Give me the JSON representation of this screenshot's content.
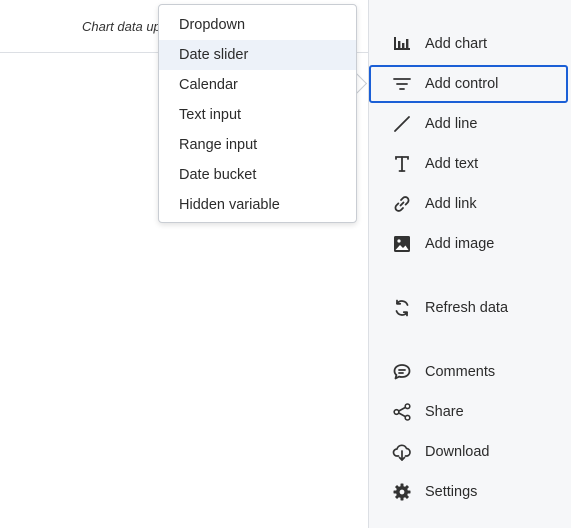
{
  "topbar": {
    "status_text": "Chart data up"
  },
  "menu": {
    "items": [
      {
        "label": "Dropdown"
      },
      {
        "label": "Date slider"
      },
      {
        "label": "Calendar"
      },
      {
        "label": "Text input"
      },
      {
        "label": "Range input"
      },
      {
        "label": "Date bucket"
      },
      {
        "label": "Hidden variable"
      }
    ],
    "hovered_item": "Date slider"
  },
  "sidebar": {
    "active_item": "Add control",
    "items": [
      {
        "label": "Add chart",
        "icon": "bar-chart-icon"
      },
      {
        "label": "Add control",
        "icon": "filter-icon"
      },
      {
        "label": "Add line",
        "icon": "line-icon"
      },
      {
        "label": "Add text",
        "icon": "text-icon"
      },
      {
        "label": "Add link",
        "icon": "link-icon"
      },
      {
        "label": "Add image",
        "icon": "image-icon"
      },
      {
        "label": "Refresh data",
        "icon": "refresh-icon"
      },
      {
        "label": "Comments",
        "icon": "comment-icon"
      },
      {
        "label": "Share",
        "icon": "share-icon"
      },
      {
        "label": "Download",
        "icon": "download-cloud-icon"
      },
      {
        "label": "Settings",
        "icon": "gear-icon"
      }
    ]
  },
  "colors": {
    "accent": "#1b5fd6",
    "sidebar_bg": "#f6f7f9",
    "hover_bg": "#edf2f9"
  }
}
